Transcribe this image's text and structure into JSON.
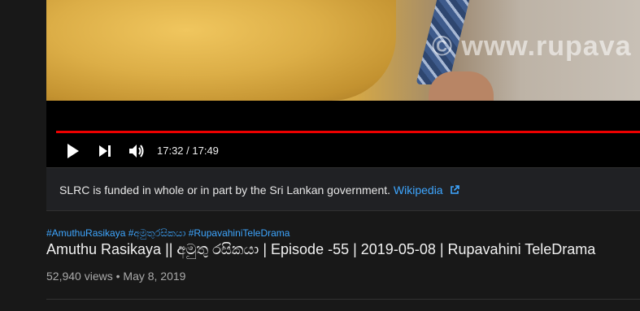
{
  "player": {
    "watermark": "© www.rupava",
    "current_time": "17:32",
    "duration": "17:49",
    "time_display": "17:32 / 17:49",
    "progress_fraction": 0.984,
    "icons": {
      "play": "play-icon",
      "next": "next-icon",
      "volume": "volume-icon"
    },
    "progress_color": "#ff0000"
  },
  "info_panel": {
    "text": "SLRC is funded in whole or in part by the Sri Lankan government.",
    "link_label": "Wikipedia",
    "link_icon": "external-link-icon"
  },
  "video": {
    "hashtags": [
      "#AmuthuRasikaya",
      "#අමුතුරසිකයා",
      "#RupavahiniTeleDrama"
    ],
    "title": "Amuthu Rasikaya || අමුතු රසිකයා | Episode -55 | 2019-05-08 | Rupavahini TeleDrama",
    "views": "52,940 views",
    "separator": "•",
    "date": "May 8, 2019"
  },
  "colors": {
    "background": "#181818",
    "link": "#3ea6ff",
    "panel": "#202124"
  }
}
